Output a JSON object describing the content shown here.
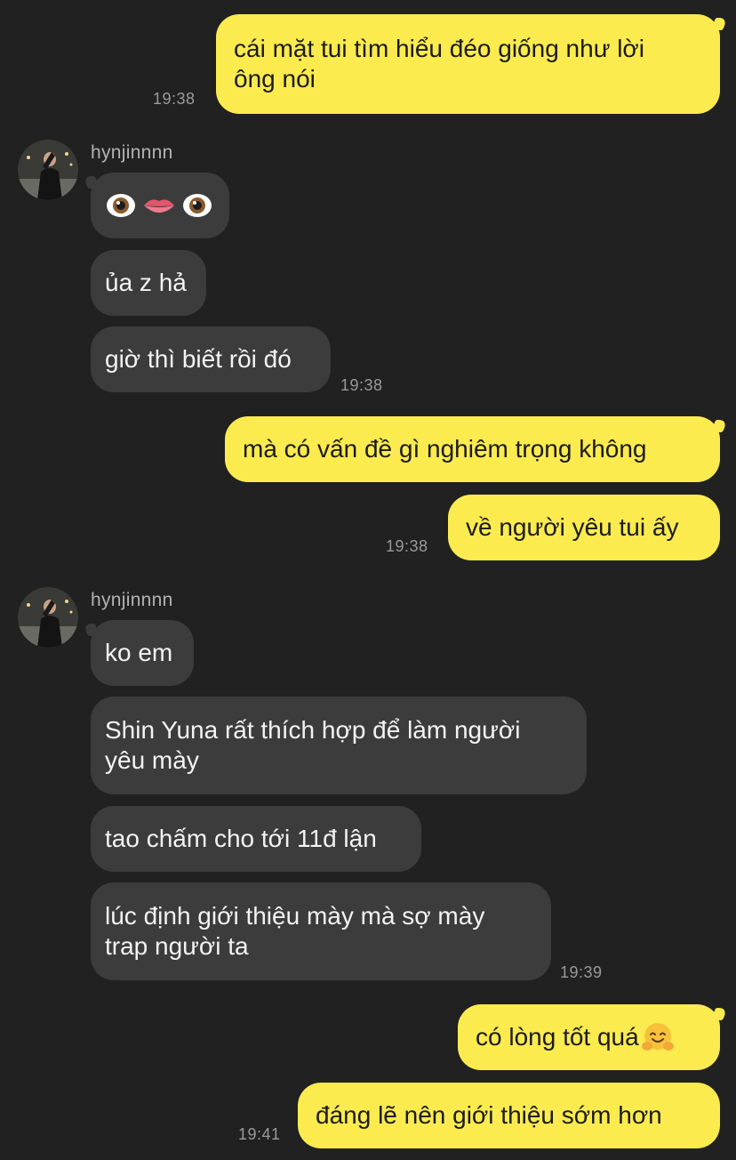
{
  "contact": {
    "name": "hynjinnnn"
  },
  "messages": [
    {
      "id": "m1",
      "direction": "out",
      "text": "cái mặt tui tìm hiểu đéo giống như lời\nông nói",
      "time": "19:38"
    },
    {
      "id": "m2",
      "direction": "in",
      "emoji": [
        "eye-emoji",
        "lips-emoji",
        "eye-emoji"
      ]
    },
    {
      "id": "m3",
      "direction": "in",
      "text": "ủa z hả"
    },
    {
      "id": "m4",
      "direction": "in",
      "text": "giờ thì biết rồi đó",
      "time": "19:38"
    },
    {
      "id": "m5",
      "direction": "out",
      "text": "mà có vấn đề gì nghiêm trọng không"
    },
    {
      "id": "m6",
      "direction": "out",
      "text": "về người yêu tui ấy",
      "time": "19:38"
    },
    {
      "id": "m7",
      "direction": "in",
      "text": "ko em"
    },
    {
      "id": "m8",
      "direction": "in",
      "text": "Shin Yuna rất thích hợp để làm người\nyêu mày"
    },
    {
      "id": "m9",
      "direction": "in",
      "text": "tao chấm cho tới 11đ lận"
    },
    {
      "id": "m10",
      "direction": "in",
      "text": "lúc định giới thiệu mày mà sợ mày\ntrap người ta",
      "time": "19:39"
    },
    {
      "id": "m11",
      "direction": "out",
      "text": "có lòng tốt quá",
      "emoji": "hugging-face-emoji"
    },
    {
      "id": "m12",
      "direction": "out",
      "text": "đáng lẽ nên giới thiệu sớm hơn",
      "time": "19:41"
    }
  ],
  "colors": {
    "background": "#212121",
    "outgoing_bubble": "#fbeb4f",
    "incoming_bubble": "#3c3c3c",
    "timestamp": "#9a9a9a",
    "sender_name": "#b3b3b3"
  }
}
